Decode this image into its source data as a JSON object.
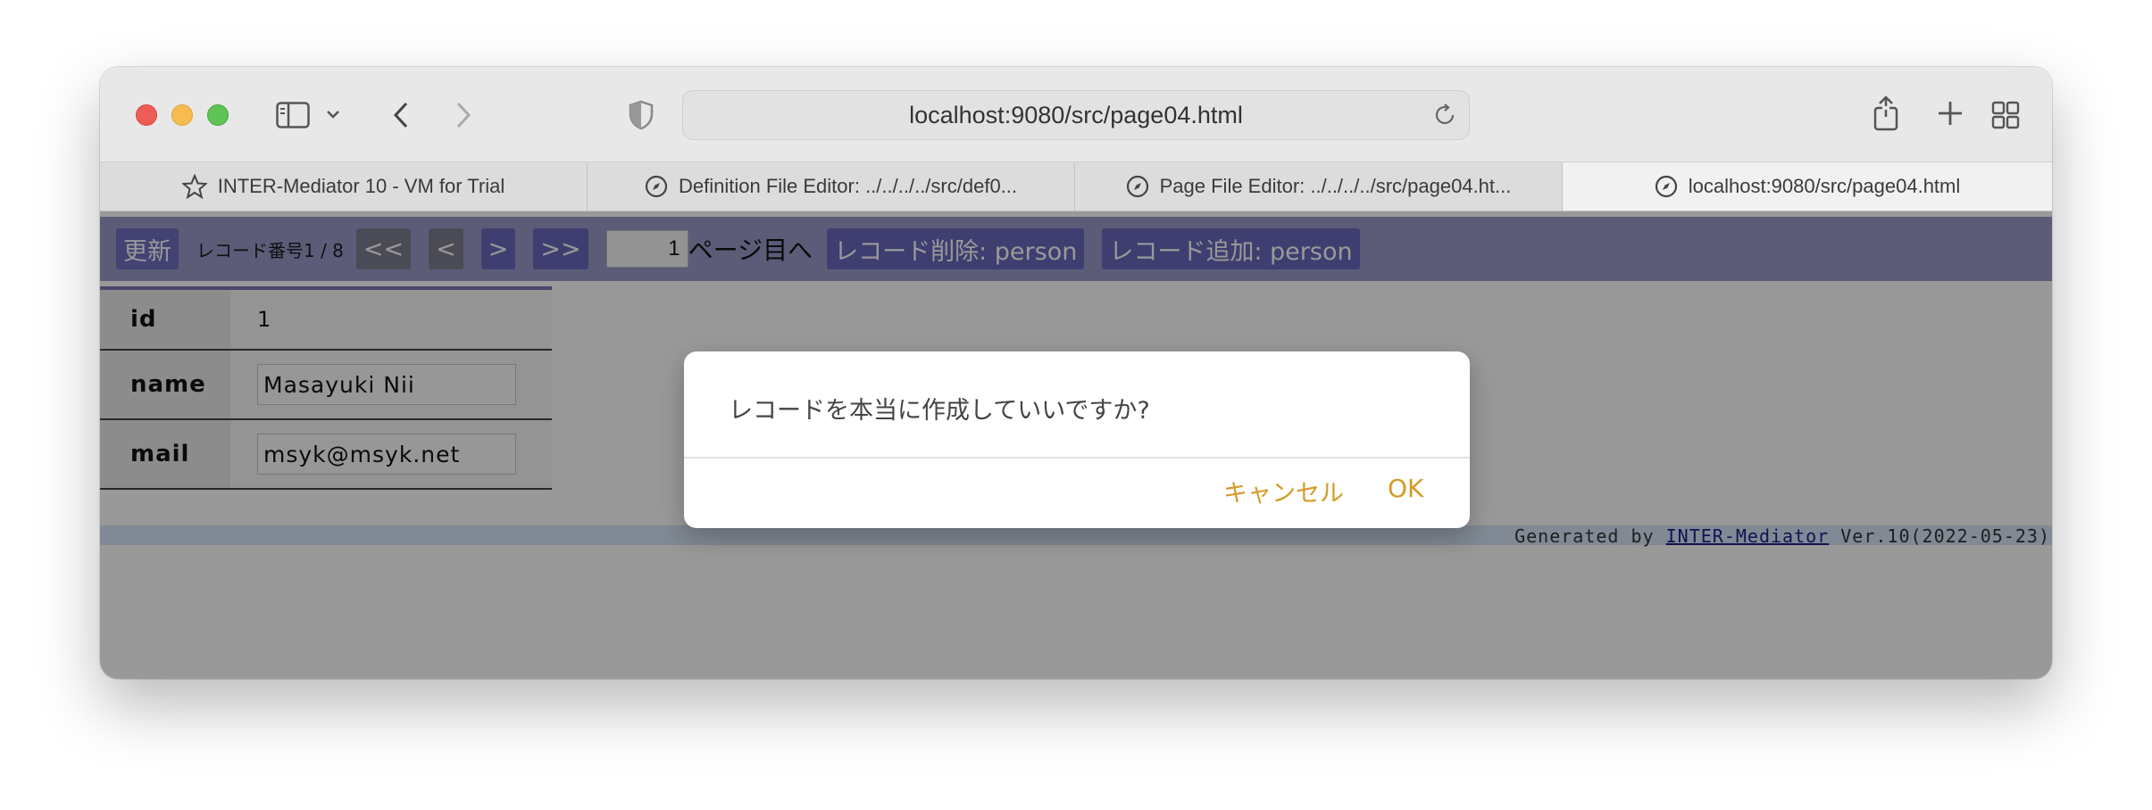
{
  "browser": {
    "url": "localhost:9080/src/page04.html",
    "tabs": [
      {
        "label": "INTER-Mediator 10 - VM for Trial",
        "icon": "star-icon"
      },
      {
        "label": "Definition File Editor: ../../../../src/def0...",
        "icon": "compass-icon"
      },
      {
        "label": "Page File Editor: ../../../../src/page04.ht...",
        "icon": "compass-icon"
      },
      {
        "label": "localhost:9080/src/page04.html",
        "icon": "compass-icon",
        "active": true
      }
    ]
  },
  "navigation": {
    "refresh": "更新",
    "record_info": "レコード番号1 / 8",
    "first": "<<",
    "prev": "<",
    "next": ">",
    "last": ">>",
    "page_value": "1",
    "page_label": "ページ目へ",
    "delete": "レコード削除: person",
    "add": "レコード追加: person"
  },
  "record": {
    "fields": [
      {
        "label": "id",
        "value": "1"
      },
      {
        "label": "name",
        "value": "Masayuki Nii"
      },
      {
        "label": "mail",
        "value": "msyk@msyk.net"
      }
    ]
  },
  "footer": {
    "prefix": "Generated by ",
    "link": "INTER-Mediator",
    "suffix": " Ver.10(2022-05-23)"
  },
  "dialog": {
    "message": "レコードを本当に作成していいですか?",
    "cancel": "キャンセル",
    "ok": "OK"
  },
  "colors": {
    "dialog_button": "#d49a26",
    "nav_bar": "#9a9ac8"
  }
}
